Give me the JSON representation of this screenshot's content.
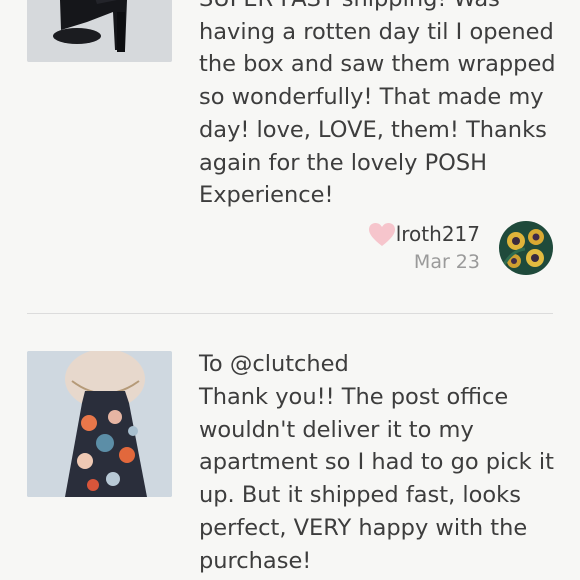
{
  "reviews": [
    {
      "text": "SUPER FAST shipping! Was\nhaving a rotten day til I opened\nthe box and saw them wrapped\nso wonderfully! That made my\nday! love, LOVE, them! Thanks\nagain for the lovely POSH\nExperience!",
      "username": "lroth217",
      "date": "Mar 23",
      "image_icon": "shoe-photo",
      "avatar_icon": "flower-avatar"
    },
    {
      "to_line": "To @clutched",
      "text": "Thank you!! The post office\nwouldn't deliver it to my\napartment so I had to go pick it\nup. But it shipped fast, looks\nperfect, VERY happy with the\npurchase!",
      "image_icon": "dress-photo"
    }
  ],
  "colors": {
    "background": "#f7f7f5",
    "text": "#3d3d3d",
    "muted": "#9a9a9a",
    "heart": "#f6c5cc",
    "divider": "#dcdcdc"
  }
}
